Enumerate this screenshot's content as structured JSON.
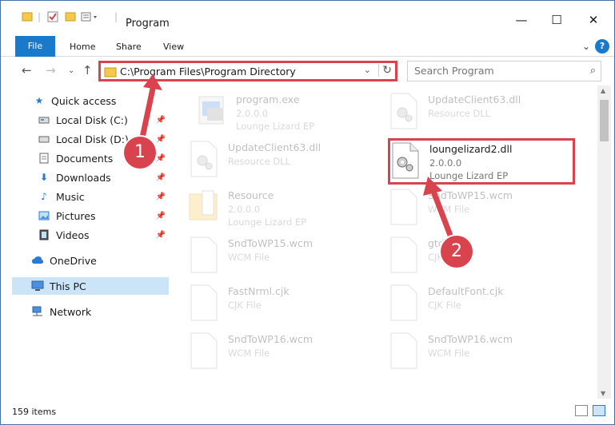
{
  "window": {
    "title": "Program",
    "minimize": "—",
    "maximize": "☐",
    "close": "✕"
  },
  "ribbon": {
    "tabs": [
      "File",
      "Home",
      "Share",
      "View"
    ],
    "help": "?"
  },
  "address": {
    "path": "C:\\Program Files\\Program Directory",
    "search_placeholder": "Search Program"
  },
  "sidebar": {
    "items": [
      {
        "label": "Quick access",
        "icon": "star-icon",
        "pinned": false
      },
      {
        "label": "Local Disk (C:)",
        "icon": "drive-icon",
        "pinned": true
      },
      {
        "label": "Local Disk (D:)",
        "icon": "drive-icon",
        "pinned": true
      },
      {
        "label": "Documents",
        "icon": "documents-icon",
        "pinned": true
      },
      {
        "label": "Downloads",
        "icon": "download-icon",
        "pinned": true
      },
      {
        "label": "Music",
        "icon": "music-icon",
        "pinned": true
      },
      {
        "label": "Pictures",
        "icon": "pictures-icon",
        "pinned": true
      },
      {
        "label": "Videos",
        "icon": "videos-icon",
        "pinned": true
      },
      {
        "label": "OneDrive",
        "icon": "cloud-icon",
        "pinned": false
      },
      {
        "label": "This PC",
        "icon": "computer-icon",
        "pinned": false,
        "selected": true
      },
      {
        "label": "Network",
        "icon": "network-icon",
        "pinned": false
      }
    ]
  },
  "files": [
    {
      "name": "program.exe",
      "version": "2.0.0.0",
      "desc": "Lounge Lizard EP",
      "icon": "exe-icon"
    },
    {
      "name": "UpdateClient63.dll",
      "version": "Resource DLL",
      "desc": "",
      "icon": "dll-icon"
    },
    {
      "name": "UpdateClient63.dll",
      "version": "Resource DLL",
      "desc": "",
      "icon": "dll-icon"
    },
    {
      "name": "loungelizard2.dll",
      "version": "2.0.0.0",
      "desc": "Lounge Lizard EP",
      "icon": "dll-icon",
      "highlighted": true
    },
    {
      "name": "Resource",
      "version": "2.0.0.0",
      "desc": "Lounge Lizard EP",
      "icon": "folder-icon"
    },
    {
      "name": "SndToWP15.wcm",
      "version": "WCM File",
      "desc": "",
      "icon": "file-icon"
    },
    {
      "name": "SndToWP15.wcm",
      "version": "WCM File",
      "desc": "",
      "icon": "file-icon"
    },
    {
      "name": "gtd",
      "version": "CJK File",
      "desc": "",
      "icon": "file-icon"
    },
    {
      "name": "FastNrml.cjk",
      "version": "CJK File",
      "desc": "",
      "icon": "file-icon"
    },
    {
      "name": "DefaultFont.cjk",
      "version": "CJK File",
      "desc": "",
      "icon": "file-icon"
    },
    {
      "name": "SndToWP16.wcm",
      "version": "WCM File",
      "desc": "",
      "icon": "file-icon"
    },
    {
      "name": "SndToWP16.wcm",
      "version": "WCM File",
      "desc": "",
      "icon": "file-icon"
    }
  ],
  "status": {
    "count": "159 items"
  },
  "annotations": {
    "one": "1",
    "two": "2",
    "color": "#d9434d"
  }
}
